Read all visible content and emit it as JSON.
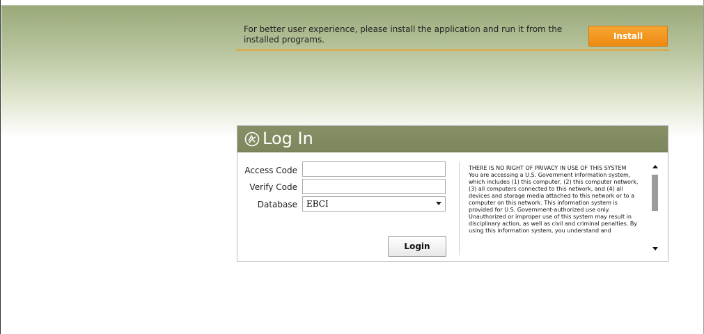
{
  "banner": {
    "text": "For better user experience, please install the application and run it from the installed programs.",
    "install_label": "Install"
  },
  "login": {
    "title": "Log In",
    "access_code_label": "Access Code",
    "access_code_value": "",
    "verify_code_label": "Verify Code",
    "verify_code_value": "",
    "database_label": "Database",
    "database_value": "EBCI",
    "login_button": "Login"
  },
  "notice": {
    "title": "THERE IS NO RIGHT OF PRIVACY IN USE OF THIS SYSTEM",
    "body": "You are accessing a U.S. Government information system, which includes (1) this computer, (2) this computer network, (3) all computers connected to this network, and (4) all devices and storage media attached to this network or to a computer on this network. This information system is provided for U.S. Government-authorized use only. Unauthorized or improper use of this system may result in disciplinary action, as well as civil and criminal penalties. By using this information system, you understand and"
  },
  "colors": {
    "accent_orange": "#f39a20",
    "header_green": "#848d63",
    "banner_rule": "#e0a640"
  },
  "icons": {
    "logo": "caduceus-emblem-icon",
    "scroll_up": "arrow-up-icon",
    "scroll_down": "arrow-down-icon",
    "select_arrow": "chevron-down-icon"
  }
}
